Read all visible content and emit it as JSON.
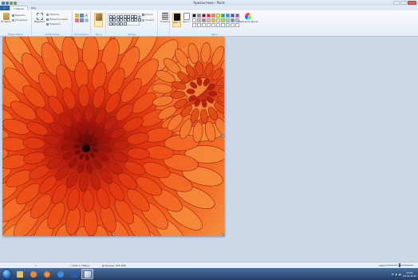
{
  "window": {
    "title": "Хризантема - Paint"
  },
  "ribbon_tabs": {
    "file_label": "",
    "tabs": [
      "Главная",
      "Вид"
    ]
  },
  "groups": {
    "clipboard": {
      "label": "Буфер обмена",
      "paste": "Вставить",
      "cut": "Вырезать",
      "copy": "Копировать"
    },
    "image": {
      "label": "Изображение",
      "select": "Выделить",
      "crop": "Обрезать",
      "resize": "Изменить размер",
      "rotate": "Повернуть"
    },
    "tools": {
      "label": "Инструменты"
    },
    "brushes": {
      "label": "Кисти"
    },
    "shapes": {
      "label": "Фигуры",
      "outline": "Контур",
      "fill": "Заливка"
    },
    "size": {
      "label": "Толщина"
    },
    "colors": {
      "label": "Цвета",
      "color1": "Цвет 1",
      "color2": "Цвет 2",
      "edit": "Изменение цветов"
    }
  },
  "colors": {
    "color1": "#111111",
    "color2": "#ffffff",
    "accent": "#2f5fa8",
    "palette": [
      "#000000",
      "#7f7f7f",
      "#880015",
      "#ed1c24",
      "#ff7f27",
      "#fff200",
      "#22b14c",
      "#00a2e8",
      "#3f48cc",
      "#a349a4",
      "#ffffff",
      "#c3c3c3",
      "#b97a57",
      "#ffaec9",
      "#ffc90e",
      "#efe4b0",
      "#b5e61d",
      "#99d9ea",
      "#7092be",
      "#c8bfe7",
      "#ffffff",
      "#ffffff",
      "#ffffff",
      "#ffffff",
      "#ffffff",
      "#ffffff",
      "#ffffff",
      "#ffffff",
      "#ffffff",
      "#ffffff"
    ]
  },
  "status": {
    "dimensions": "1024 × 768пкс",
    "filesize": "Размер: 835,9КБ",
    "zoom": "100%"
  },
  "taskbar": {
    "time": "12:01",
    "date": "29.01.2015"
  },
  "icons": {
    "taskbar": [
      "start-orb",
      "explorer-icon",
      "media-player-icon",
      "firefox-icon",
      "ie-icon",
      "word-icon",
      "paint-icon"
    ]
  }
}
